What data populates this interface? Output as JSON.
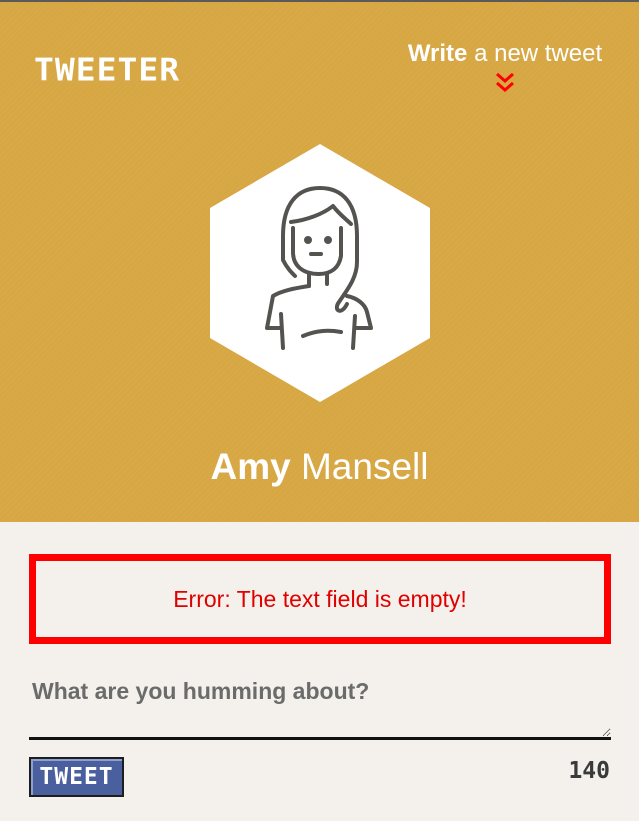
{
  "header": {
    "logo": "TWEETER",
    "compose_bold": "Write",
    "compose_rest": " a new tweet",
    "chevron_icon": "double-chevron-down-icon",
    "background": "#d7a743"
  },
  "profile": {
    "first_name": "Amy",
    "last_name": " Mansell",
    "avatar_icon": "woman-avatar-icon"
  },
  "error": {
    "message": "Error: The text field is empty!",
    "color": "#ff0000"
  },
  "composer": {
    "placeholder": "What are you humming about?",
    "value": "",
    "button_label": "TWEET",
    "char_count": "140",
    "button_color": "#4a5f9e"
  }
}
